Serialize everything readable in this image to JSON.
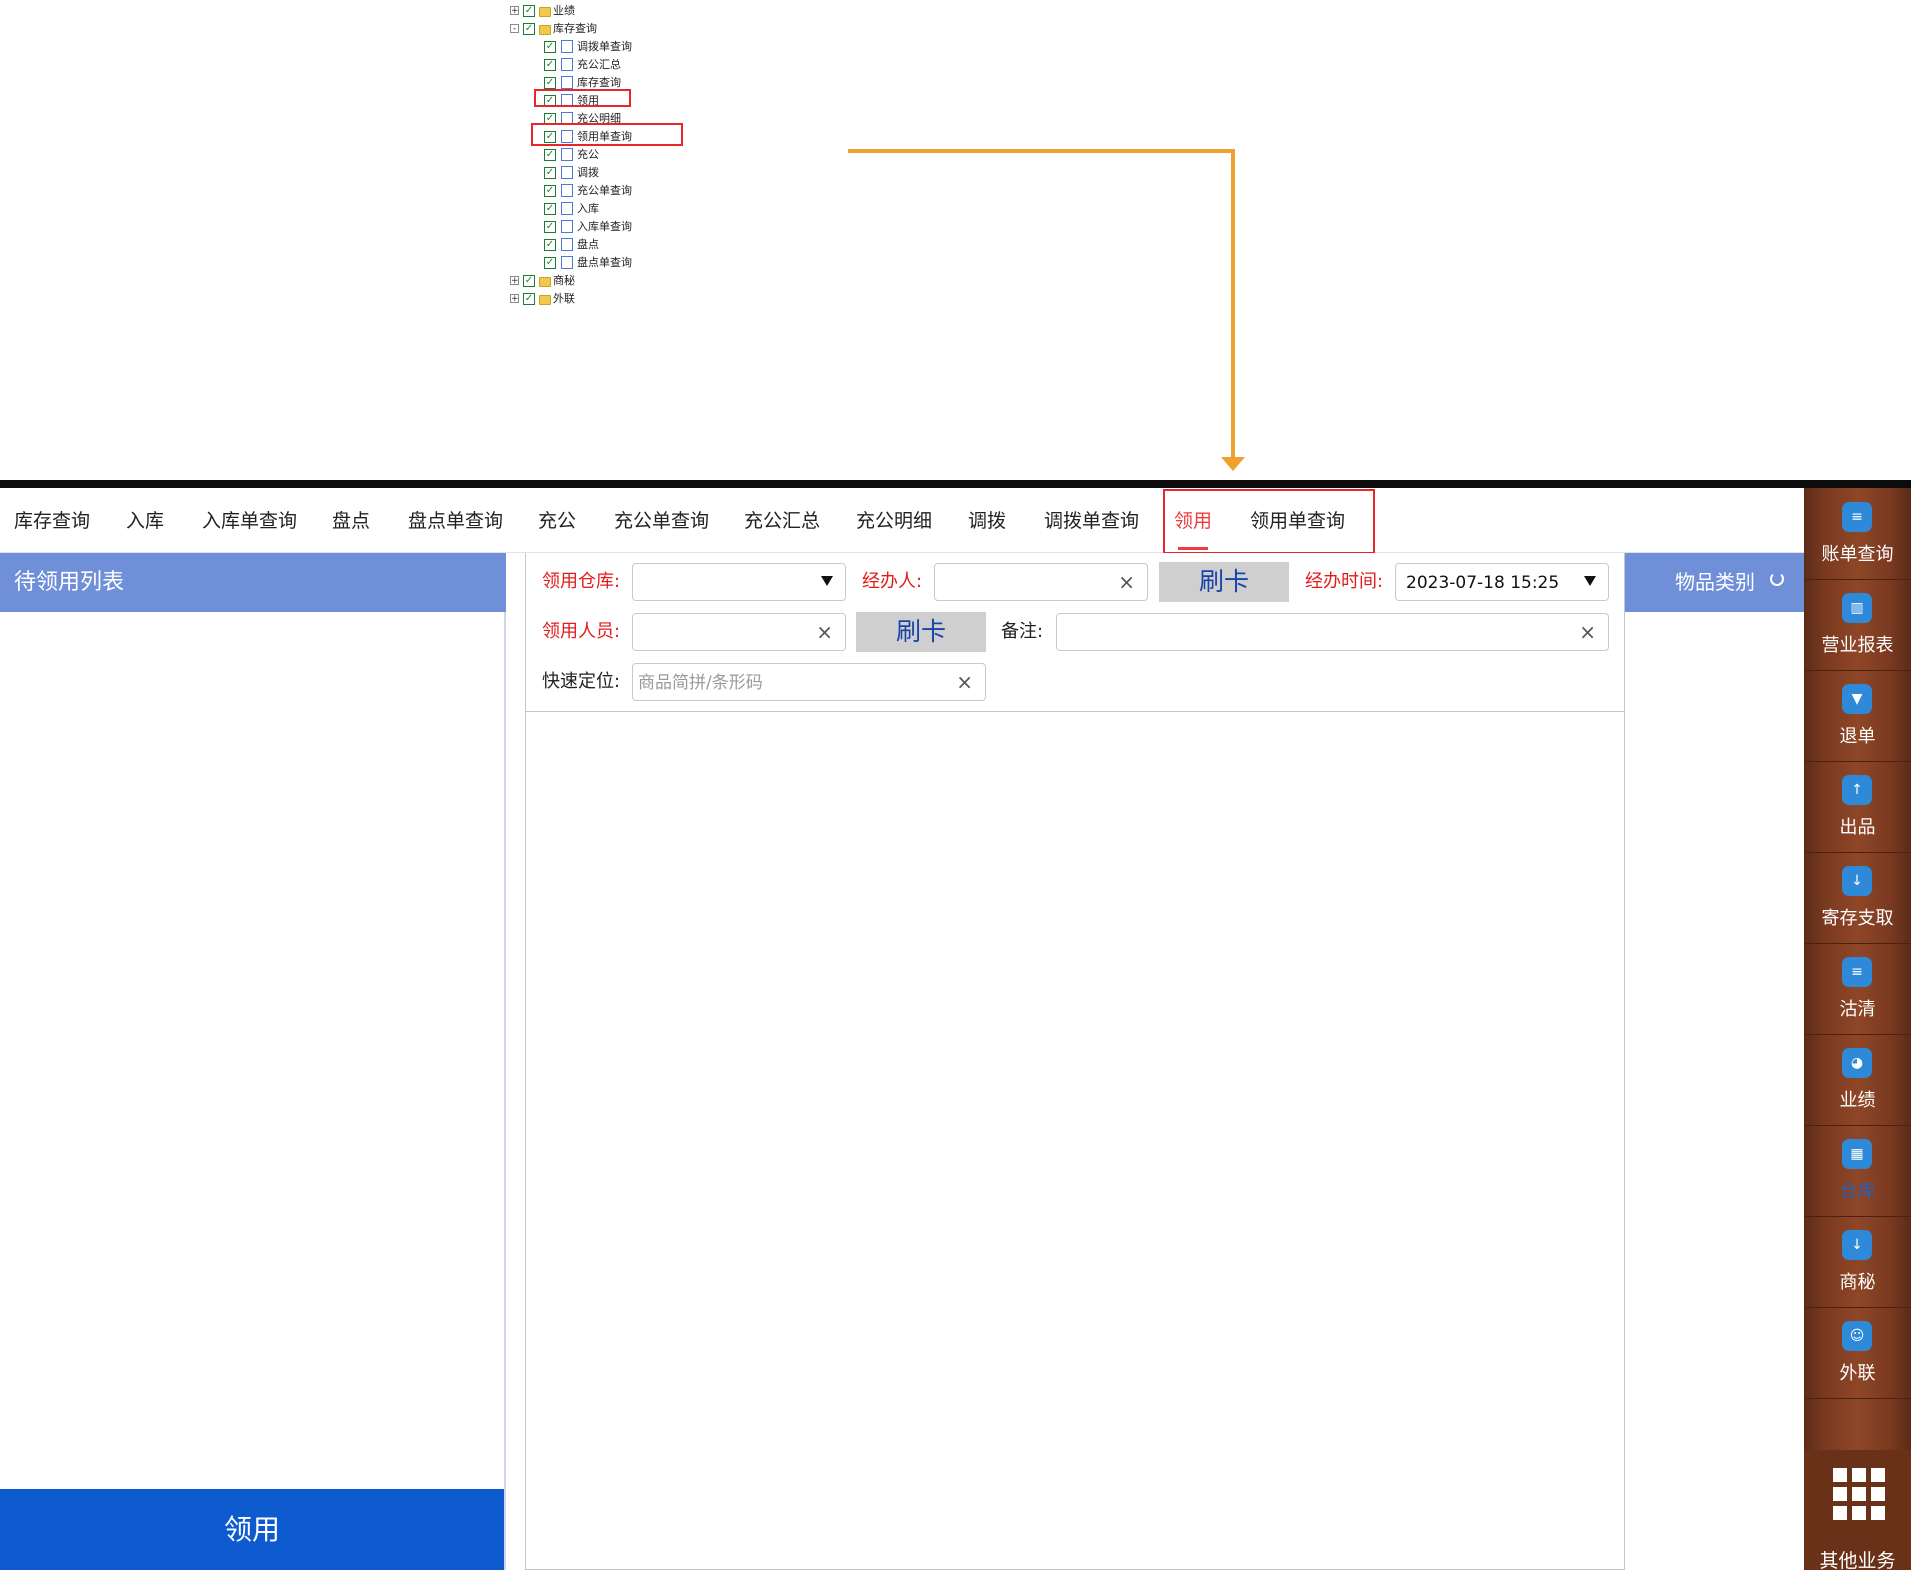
{
  "tree": {
    "nodes": [
      {
        "label": "业绩",
        "level": 0,
        "type": "folder",
        "toggle": "+"
      },
      {
        "label": "库存查询",
        "level": 0,
        "type": "folder",
        "toggle": "-"
      },
      {
        "label": "调拨单查询",
        "level": 1,
        "type": "page"
      },
      {
        "label": "充公汇总",
        "level": 1,
        "type": "page"
      },
      {
        "label": "库存查询",
        "level": 1,
        "type": "page"
      },
      {
        "label": "领用",
        "level": 1,
        "type": "page"
      },
      {
        "label": "充公明细",
        "level": 1,
        "type": "page"
      },
      {
        "label": "领用单查询",
        "level": 1,
        "type": "page"
      },
      {
        "label": "充公",
        "level": 1,
        "type": "page"
      },
      {
        "label": "调拨",
        "level": 1,
        "type": "page"
      },
      {
        "label": "充公单查询",
        "level": 1,
        "type": "page"
      },
      {
        "label": "入库",
        "level": 1,
        "type": "page"
      },
      {
        "label": "入库单查询",
        "level": 1,
        "type": "page"
      },
      {
        "label": "盘点",
        "level": 1,
        "type": "page"
      },
      {
        "label": "盘点单查询",
        "level": 1,
        "type": "page"
      },
      {
        "label": "商秘",
        "level": 0,
        "type": "folder",
        "toggle": "+"
      },
      {
        "label": "外联",
        "level": 0,
        "type": "folder",
        "toggle": "+"
      }
    ],
    "checkmark": "✓"
  },
  "tabs": [
    {
      "label": "库存查询"
    },
    {
      "label": "入库"
    },
    {
      "label": "入库单查询"
    },
    {
      "label": "盘点"
    },
    {
      "label": "盘点单查询"
    },
    {
      "label": "充公"
    },
    {
      "label": "充公单查询"
    },
    {
      "label": "充公汇总"
    },
    {
      "label": "充公明细"
    },
    {
      "label": "调拨"
    },
    {
      "label": "调拨单查询"
    },
    {
      "label": "领用",
      "active": true
    },
    {
      "label": "领用单查询"
    }
  ],
  "left_panel": {
    "title": "待领用列表",
    "action_button": "领用"
  },
  "form": {
    "warehouse_label": "领用仓库:",
    "warehouse_value": "",
    "handler_label": "经办人:",
    "handler_value": "",
    "swipe_label": "刷卡",
    "time_label": "经办时间:",
    "time_value": "2023-07-18 15:25",
    "recipient_label": "领用人员:",
    "recipient_value": "",
    "remark_label": "备注:",
    "remark_value": "",
    "locate_label": "快速定位:",
    "locate_placeholder": "商品简拼/条形码",
    "clear_symbol": "×"
  },
  "category_panel": {
    "title": "物品类别"
  },
  "sidebar": {
    "items": [
      {
        "label": "账单查询",
        "icon": "bill-query-icon",
        "glyph": "≡"
      },
      {
        "label": "营业报表",
        "icon": "report-icon",
        "glyph": "▥"
      },
      {
        "label": "退单",
        "icon": "refund-icon",
        "glyph": "▼"
      },
      {
        "label": "出品",
        "icon": "dispatch-icon",
        "glyph": "↑"
      },
      {
        "label": "寄存支取",
        "icon": "deposit-icon",
        "glyph": "↓"
      },
      {
        "label": "沽清",
        "icon": "sellout-icon",
        "glyph": "≡"
      },
      {
        "label": "业绩",
        "icon": "performance-icon",
        "glyph": "◕"
      },
      {
        "label": "仓库",
        "icon": "warehouse-icon",
        "glyph": "▦",
        "active": true
      },
      {
        "label": "商秘",
        "icon": "secretary-icon",
        "glyph": "↓"
      },
      {
        "label": "外联",
        "icon": "outreach-icon",
        "glyph": "☺"
      }
    ],
    "more_label": "其他业务"
  }
}
